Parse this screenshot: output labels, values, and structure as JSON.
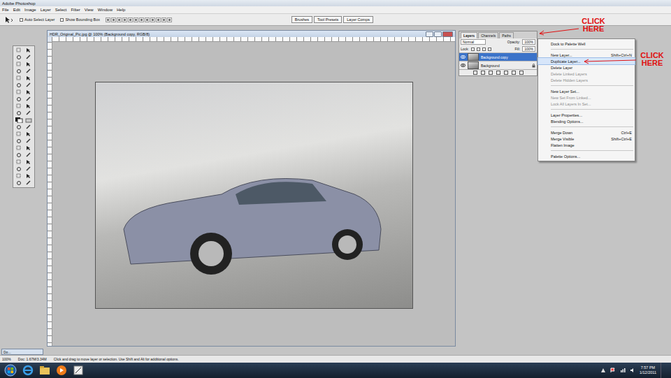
{
  "app_title": "Adobe Photoshop",
  "menu": [
    "File",
    "Edit",
    "Image",
    "Layer",
    "Select",
    "Filter",
    "View",
    "Window",
    "Help"
  ],
  "options_bar": {
    "auto_select": {
      "label": "Auto Select Layer",
      "checked": false
    },
    "bounding_box": {
      "label": "Show Bounding Box",
      "checked": false
    },
    "well_tabs": [
      "Brushes",
      "Tool Presets",
      "Layer Comps"
    ]
  },
  "document": {
    "title": "HDR_Original_Pic.jpg @ 100% (Background copy, RGB/8)"
  },
  "layers_panel": {
    "tabs": [
      {
        "label": "Layers",
        "selected": true
      },
      {
        "label": "Channels",
        "selected": false
      },
      {
        "label": "Paths",
        "selected": false
      }
    ],
    "blend_mode": "Normal",
    "opacity_label": "Opacity:",
    "opacity": "100%",
    "lock_label": "Lock:",
    "fill_label": "Fill:",
    "fill": "100%",
    "layers": [
      {
        "name": "Background copy",
        "selected": true,
        "visible": true,
        "locked": false
      },
      {
        "name": "Background",
        "selected": false,
        "visible": true,
        "locked": true
      }
    ]
  },
  "context_menu": {
    "items": [
      {
        "kind": "item",
        "label": "Dock to Palette Well",
        "shortcut": "",
        "disabled": false,
        "selected": false
      },
      {
        "kind": "separator"
      },
      {
        "kind": "item",
        "label": "New Layer...",
        "shortcut": "Shift+Ctrl+N",
        "disabled": false,
        "selected": false
      },
      {
        "kind": "item",
        "label": "Duplicate Layer...",
        "shortcut": "",
        "disabled": false,
        "selected": true
      },
      {
        "kind": "item",
        "label": "Delete Layer",
        "shortcut": "",
        "disabled": false,
        "selected": false
      },
      {
        "kind": "item",
        "label": "Delete Linked Layers",
        "shortcut": "",
        "disabled": true,
        "selected": false
      },
      {
        "kind": "item",
        "label": "Delete Hidden Layers",
        "shortcut": "",
        "disabled": true,
        "selected": false
      },
      {
        "kind": "separator"
      },
      {
        "kind": "item",
        "label": "New Layer Set...",
        "shortcut": "",
        "disabled": false,
        "selected": false
      },
      {
        "kind": "item",
        "label": "New Set From Linked...",
        "shortcut": "",
        "disabled": true,
        "selected": false
      },
      {
        "kind": "item",
        "label": "Lock All Layers In Set...",
        "shortcut": "",
        "disabled": true,
        "selected": false
      },
      {
        "kind": "separator"
      },
      {
        "kind": "item",
        "label": "Layer Properties...",
        "shortcut": "",
        "disabled": false,
        "selected": false
      },
      {
        "kind": "item",
        "label": "Blending Options...",
        "shortcut": "",
        "disabled": false,
        "selected": false
      },
      {
        "kind": "separator"
      },
      {
        "kind": "item",
        "label": "Merge Down",
        "shortcut": "Ctrl+E",
        "disabled": false,
        "selected": false
      },
      {
        "kind": "item",
        "label": "Merge Visible",
        "shortcut": "Shift+Ctrl+E",
        "disabled": false,
        "selected": false
      },
      {
        "kind": "item",
        "label": "Flatten Image",
        "shortcut": "",
        "disabled": false,
        "selected": false
      },
      {
        "kind": "separator"
      },
      {
        "kind": "item",
        "label": "Palette Options...",
        "shortcut": "",
        "disabled": false,
        "selected": false
      }
    ]
  },
  "annotations": [
    {
      "text": "CLICK HERE",
      "color": "#e01010"
    },
    {
      "text": "CLICK HERE",
      "color": "#e01010"
    }
  ],
  "minimized_doc": "Do...",
  "status_bar": {
    "zoom": "100%",
    "doc": "Doc: 1.67M/3.34M",
    "hint": "Click and drag to move layer or selection. Use Shift and Alt for additional options."
  },
  "taskbar": {
    "time": "7:57 PM",
    "date": "1/12/2011"
  }
}
